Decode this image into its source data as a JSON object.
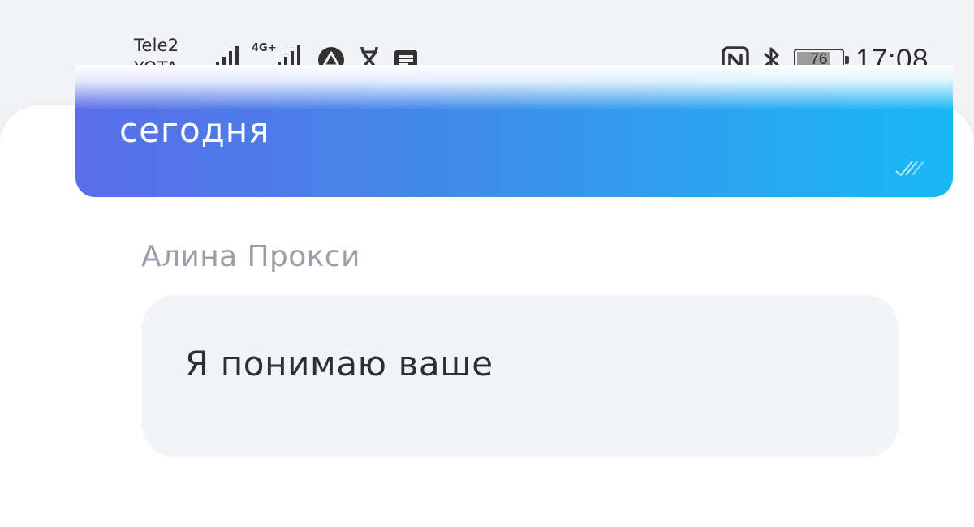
{
  "status_bar": {
    "carrier_1": "Tele2",
    "carrier_2": "YOTA",
    "network_badge": "4G+",
    "battery_level": "76",
    "battery_fraction": 0.76,
    "time": "17:08",
    "icons_left": [
      "signal-bars-icon",
      "signal-4g-icon",
      "app-notification-icon",
      "dna-app-icon",
      "message-notification-icon"
    ],
    "icons_right": [
      "nfc-icon",
      "bluetooth-icon",
      "battery-icon"
    ]
  },
  "chat": {
    "outgoing_message_text": "сегодня",
    "incoming_sender": "Алина Прокси",
    "incoming_message_text": "Я понимаю ваше"
  },
  "colors": {
    "outgoing_gradient_start": "#5a6de8",
    "outgoing_gradient_end": "#18b8f4",
    "incoming_bubble": "#f3f4f7",
    "sender_name": "#9aa0aa"
  }
}
